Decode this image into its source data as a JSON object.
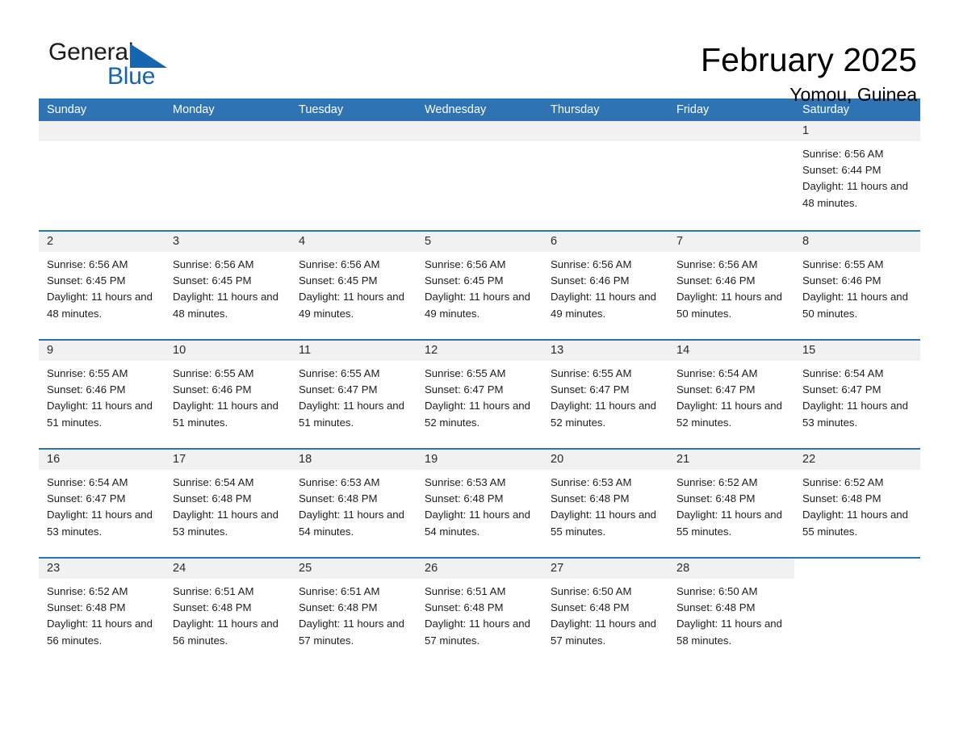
{
  "brand": {
    "name_part1": "General",
    "name_part2": "Blue",
    "logo_icon": "triangle-icon",
    "accent_color": "#1565b0"
  },
  "header": {
    "month_title": "February 2025",
    "location": "Yomou, Guinea"
  },
  "theme": {
    "header_blue": "#2e74b5",
    "date_band_gray": "#f1f1f1",
    "text_color": "#1d1d1d"
  },
  "calendar": {
    "weekdays": [
      "Sunday",
      "Monday",
      "Tuesday",
      "Wednesday",
      "Thursday",
      "Friday",
      "Saturday"
    ],
    "weeks": [
      [
        {
          "day": "",
          "empty": true
        },
        {
          "day": "",
          "empty": true
        },
        {
          "day": "",
          "empty": true
        },
        {
          "day": "",
          "empty": true
        },
        {
          "day": "",
          "empty": true
        },
        {
          "day": "",
          "empty": true
        },
        {
          "day": "1",
          "sunrise": "Sunrise: 6:56 AM",
          "sunset": "Sunset: 6:44 PM",
          "daylight": "Daylight: 11 hours and 48 minutes."
        }
      ],
      [
        {
          "day": "2",
          "sunrise": "Sunrise: 6:56 AM",
          "sunset": "Sunset: 6:45 PM",
          "daylight": "Daylight: 11 hours and 48 minutes."
        },
        {
          "day": "3",
          "sunrise": "Sunrise: 6:56 AM",
          "sunset": "Sunset: 6:45 PM",
          "daylight": "Daylight: 11 hours and 48 minutes."
        },
        {
          "day": "4",
          "sunrise": "Sunrise: 6:56 AM",
          "sunset": "Sunset: 6:45 PM",
          "daylight": "Daylight: 11 hours and 49 minutes."
        },
        {
          "day": "5",
          "sunrise": "Sunrise: 6:56 AM",
          "sunset": "Sunset: 6:45 PM",
          "daylight": "Daylight: 11 hours and 49 minutes."
        },
        {
          "day": "6",
          "sunrise": "Sunrise: 6:56 AM",
          "sunset": "Sunset: 6:46 PM",
          "daylight": "Daylight: 11 hours and 49 minutes."
        },
        {
          "day": "7",
          "sunrise": "Sunrise: 6:56 AM",
          "sunset": "Sunset: 6:46 PM",
          "daylight": "Daylight: 11 hours and 50 minutes."
        },
        {
          "day": "8",
          "sunrise": "Sunrise: 6:55 AM",
          "sunset": "Sunset: 6:46 PM",
          "daylight": "Daylight: 11 hours and 50 minutes."
        }
      ],
      [
        {
          "day": "9",
          "sunrise": "Sunrise: 6:55 AM",
          "sunset": "Sunset: 6:46 PM",
          "daylight": "Daylight: 11 hours and 51 minutes."
        },
        {
          "day": "10",
          "sunrise": "Sunrise: 6:55 AM",
          "sunset": "Sunset: 6:46 PM",
          "daylight": "Daylight: 11 hours and 51 minutes."
        },
        {
          "day": "11",
          "sunrise": "Sunrise: 6:55 AM",
          "sunset": "Sunset: 6:47 PM",
          "daylight": "Daylight: 11 hours and 51 minutes."
        },
        {
          "day": "12",
          "sunrise": "Sunrise: 6:55 AM",
          "sunset": "Sunset: 6:47 PM",
          "daylight": "Daylight: 11 hours and 52 minutes."
        },
        {
          "day": "13",
          "sunrise": "Sunrise: 6:55 AM",
          "sunset": "Sunset: 6:47 PM",
          "daylight": "Daylight: 11 hours and 52 minutes."
        },
        {
          "day": "14",
          "sunrise": "Sunrise: 6:54 AM",
          "sunset": "Sunset: 6:47 PM",
          "daylight": "Daylight: 11 hours and 52 minutes."
        },
        {
          "day": "15",
          "sunrise": "Sunrise: 6:54 AM",
          "sunset": "Sunset: 6:47 PM",
          "daylight": "Daylight: 11 hours and 53 minutes."
        }
      ],
      [
        {
          "day": "16",
          "sunrise": "Sunrise: 6:54 AM",
          "sunset": "Sunset: 6:47 PM",
          "daylight": "Daylight: 11 hours and 53 minutes."
        },
        {
          "day": "17",
          "sunrise": "Sunrise: 6:54 AM",
          "sunset": "Sunset: 6:48 PM",
          "daylight": "Daylight: 11 hours and 53 minutes."
        },
        {
          "day": "18",
          "sunrise": "Sunrise: 6:53 AM",
          "sunset": "Sunset: 6:48 PM",
          "daylight": "Daylight: 11 hours and 54 minutes."
        },
        {
          "day": "19",
          "sunrise": "Sunrise: 6:53 AM",
          "sunset": "Sunset: 6:48 PM",
          "daylight": "Daylight: 11 hours and 54 minutes."
        },
        {
          "day": "20",
          "sunrise": "Sunrise: 6:53 AM",
          "sunset": "Sunset: 6:48 PM",
          "daylight": "Daylight: 11 hours and 55 minutes."
        },
        {
          "day": "21",
          "sunrise": "Sunrise: 6:52 AM",
          "sunset": "Sunset: 6:48 PM",
          "daylight": "Daylight: 11 hours and 55 minutes."
        },
        {
          "day": "22",
          "sunrise": "Sunrise: 6:52 AM",
          "sunset": "Sunset: 6:48 PM",
          "daylight": "Daylight: 11 hours and 55 minutes."
        }
      ],
      [
        {
          "day": "23",
          "sunrise": "Sunrise: 6:52 AM",
          "sunset": "Sunset: 6:48 PM",
          "daylight": "Daylight: 11 hours and 56 minutes."
        },
        {
          "day": "24",
          "sunrise": "Sunrise: 6:51 AM",
          "sunset": "Sunset: 6:48 PM",
          "daylight": "Daylight: 11 hours and 56 minutes."
        },
        {
          "day": "25",
          "sunrise": "Sunrise: 6:51 AM",
          "sunset": "Sunset: 6:48 PM",
          "daylight": "Daylight: 11 hours and 57 minutes."
        },
        {
          "day": "26",
          "sunrise": "Sunrise: 6:51 AM",
          "sunset": "Sunset: 6:48 PM",
          "daylight": "Daylight: 11 hours and 57 minutes."
        },
        {
          "day": "27",
          "sunrise": "Sunrise: 6:50 AM",
          "sunset": "Sunset: 6:48 PM",
          "daylight": "Daylight: 11 hours and 57 minutes."
        },
        {
          "day": "28",
          "sunrise": "Sunrise: 6:50 AM",
          "sunset": "Sunset: 6:48 PM",
          "daylight": "Daylight: 11 hours and 58 minutes."
        },
        {
          "day": "",
          "empty": true,
          "no_band": true
        }
      ]
    ]
  }
}
